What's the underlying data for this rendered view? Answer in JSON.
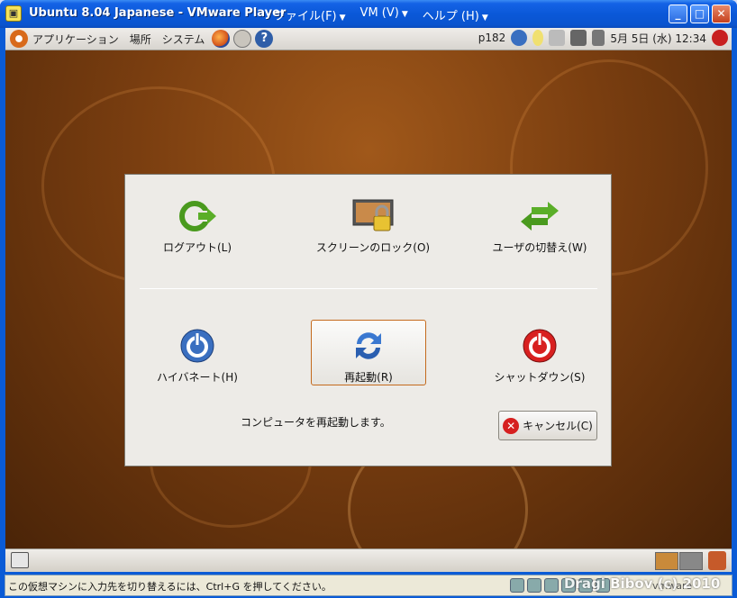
{
  "window": {
    "title": "Ubuntu 8.04 Japanese - VMware Player",
    "menus": [
      {
        "label": "ファイル(F)"
      },
      {
        "label": "VM (V)"
      },
      {
        "label": "ヘルプ (H)"
      }
    ]
  },
  "top_panel": {
    "applications": "アプリケーション",
    "places": "場所",
    "system": "システム",
    "hostname": "p182",
    "clock": "5月 5日 (水) 12:34"
  },
  "dialog": {
    "logout": "ログアウト(L)",
    "lock_screen": "スクリーンのロック(O)",
    "switch_user": "ユーザの切替え(W)",
    "hibernate": "ハイバネート(H)",
    "restart": "再起動(R)",
    "shutdown": "シャットダウン(S)",
    "message": "コンピュータを再起動します。",
    "cancel": "キャンセル(C)"
  },
  "status_bar": {
    "hint": "この仮想マシンに入力先を切り替えるには、Ctrl+G を押してください。",
    "watermark": "Dragi Bibov (c) 2010",
    "vmware": "vmware"
  },
  "colors": {
    "xp_blue": "#0a5bd6",
    "desktop_brown": "#7a3e10",
    "focus_orange": "#c46a1d"
  }
}
